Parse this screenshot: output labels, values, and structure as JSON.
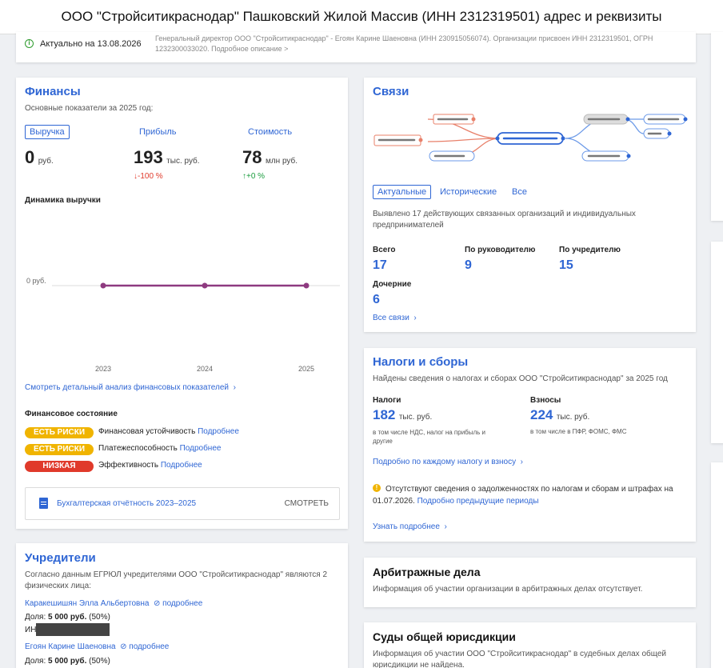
{
  "page_title": "ООО \"Стройситикраснодар\" Пашковский Жилой Массив (ИНН 2312319501) адрес и реквизиты",
  "status": {
    "actual_label": "Актуально на 13.08.2026",
    "description": "Генеральный директор ООО \"Стройситикраснодар\" - Егоян Карине Шаеновна (ИНН 230915056074). Организации присвоен ИНН 2312319501, ОГРН 1232300033020.",
    "more_link": "Подробное описание >"
  },
  "finance": {
    "title": "Финансы",
    "subtitle": "Основные показатели за 2025 год:",
    "tabs": [
      "Выручка",
      "Прибыль",
      "Стоимость"
    ],
    "revenue": {
      "value": "0",
      "unit": "руб."
    },
    "profit": {
      "value": "193",
      "unit": "тыс. руб.",
      "delta": "↓-100 %"
    },
    "cost": {
      "value": "78",
      "unit": "млн руб.",
      "delta": "↑+0 %"
    },
    "dynamics_title": "Динамика выручки",
    "analysis_link": "Смотреть детальный анализ финансовых показателей",
    "state_title": "Финансовое состояние",
    "states": [
      {
        "badge": "ЕСТЬ РИСКИ",
        "label": "Финансовая устойчивость",
        "link": "Подробнее"
      },
      {
        "badge": "ЕСТЬ РИСКИ",
        "label": "Платежеспособность",
        "link": "Подробнее"
      },
      {
        "badge": "НИЗКАЯ",
        "label": "Эффективность",
        "link": "Подробнее"
      }
    ],
    "report_label": "Бухгалтерская отчётность 2023–2025",
    "report_button": "СМОТРЕТЬ"
  },
  "chart_data": {
    "type": "line",
    "title": "Динамика выручки",
    "x": [
      "2023",
      "2024",
      "2025"
    ],
    "series": [
      {
        "values": [
          0,
          0,
          0
        ]
      }
    ],
    "y_tick_labels": [
      "0 руб."
    ],
    "color": "#8e3a80"
  },
  "founders": {
    "title": "Учредители",
    "text": "Согласно данным ЕГРЮЛ учредителями ООО \"Стройситикраснодар\" являются 2 физических лица:",
    "more": "подробнее",
    "share_label": "Доля:",
    "inn_label": "ИН",
    "people": [
      {
        "name": "Каракешишян Элла Альбертовна",
        "share": "5 000 руб.",
        "pct": "(50%)"
      },
      {
        "name": "Егоян Карине Шаеновна",
        "share": "5 000 руб.",
        "pct": "(50%)"
      }
    ]
  },
  "links": {
    "title": "Связи",
    "tabs": [
      "Актуальные",
      "Исторические",
      "Все"
    ],
    "text": "Выявлено 17 действующих связанных организаций и индивидуальных предпринимателей",
    "stats": [
      {
        "label": "Всего",
        "value": "17"
      },
      {
        "label": "По руководителю",
        "value": "9"
      },
      {
        "label": "По учредителю",
        "value": "15"
      },
      {
        "label": "Дочерние",
        "value": "6"
      }
    ],
    "all_link": "Все связи"
  },
  "taxes": {
    "title": "Налоги и сборы",
    "subtitle": "Найдены сведения о налогах и сборах ООО \"Стройситикраснодар\" за 2025 год",
    "tax": {
      "label": "Налоги",
      "value": "182",
      "unit": "тыс. руб.",
      "note": "в том числе НДС, налог на прибыль и другие"
    },
    "fees": {
      "label": "Взносы",
      "value": "224",
      "unit": "тыс. руб.",
      "note": "в том числе в ПФР, ФОМС, ФМС"
    },
    "detail_link": "Подробно по каждому налогу и взносу",
    "warning": "Отсутствуют сведения о задолженностях по налогам и сборам и штрафах на 01.07.2026.",
    "warning_link": "Подробно предыдущие периоды",
    "more": "Узнать подробнее"
  },
  "arbitration": {
    "title": "Арбитражные дела",
    "text": "Информация об участии организации в арбитражных делах отсутствует."
  },
  "courts": {
    "title": "Суды общей юрисдикции",
    "text": "Информация об участии ООО \"Стройситикраснодар\" в судебных делах общей юрисдикции не найдена."
  },
  "colors": {
    "accent": "#2f66d4",
    "warning": "#f0b400",
    "danger": "#e03a2b",
    "up": "#1a9c3e",
    "down": "#e03a2b"
  }
}
